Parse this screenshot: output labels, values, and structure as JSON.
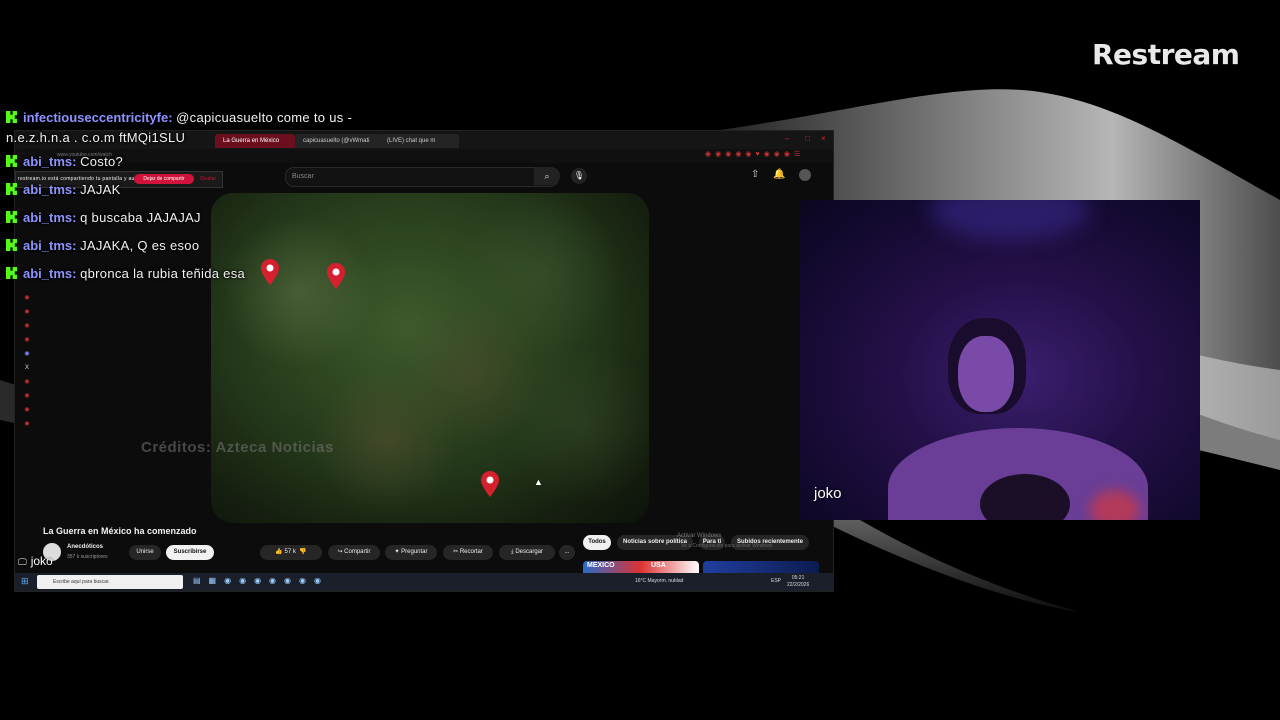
{
  "overlay": {
    "brand": "Restream"
  },
  "chat": [
    {
      "user": "infectiouseccentricityfe:",
      "message": "@capicuasuelto come to us -",
      "message_line2": "n.e.z.h.n.a . c.o.m ftMQi1SLU"
    },
    {
      "user": "abi_tms:",
      "message": "Costo?"
    },
    {
      "user": "abi_tms:",
      "message": "JAJAK"
    },
    {
      "user": "abi_tms:",
      "message": "q buscaba JAJAJAJ"
    },
    {
      "user": "abi_tms:",
      "message": "JAJAKA, Q es esoo"
    },
    {
      "user": "abi_tms:",
      "message": "qbronca la rubia teñida esa"
    }
  ],
  "screen_share": {
    "label": "joko",
    "tabs": [
      "La Guerra en México",
      "capicuasuelto (@vWmati",
      "(LIVE) chat que m"
    ],
    "url": "www.youtube.com/watch",
    "share_notice": "restream.io está compartiendo tu pantalla y audio.",
    "stop_sharing": "Dejar de compartir",
    "hide": "Ocultar",
    "search_placeholder": "Buscar",
    "video_credit": "Créditos: Azteca Noticias",
    "video_title": "La Guerra en México ha comenzado",
    "channel": "Anecdóticos",
    "subscribers": "357 k suscriptores",
    "join": "Unirse",
    "subscribe": "Suscribirse",
    "likes": "57 k",
    "share": "Compartir",
    "ask": "Preguntar",
    "clip": "Recortar",
    "download": "Descargar",
    "more": "...",
    "chips": [
      "Todos",
      "Noticias sobre política",
      "Para ti",
      "Subidos recientemente"
    ],
    "thumb1_text": "MEXICO",
    "thumb1_text2": "USA",
    "activate_windows": "Activar Windows",
    "activate_windows_sub": "Ve a Configuración para activar Windows.",
    "taskbar_search": "Escribe aquí para buscar.",
    "weather": "16°C  Mayorm. nublad",
    "lang": "ESP",
    "time": "05:21",
    "date": "22/2/2026"
  },
  "camera": {
    "label": "joko"
  },
  "colors": {
    "kick_green": "#53fc18",
    "username": "#8f93ff",
    "pin_red": "#d6202e",
    "stop_button": "#d1123a"
  }
}
